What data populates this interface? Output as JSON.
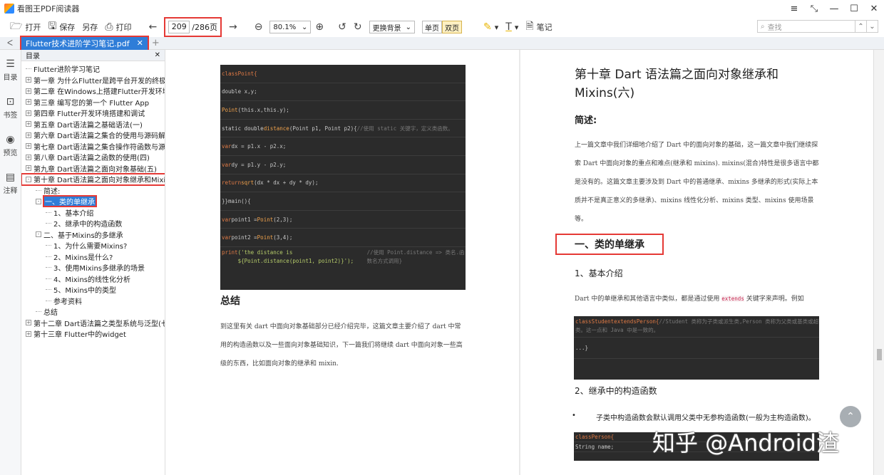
{
  "window": {
    "title": "看图王PDF阅读器",
    "controls": [
      "≡",
      "⤡",
      "—",
      "☐",
      "✕"
    ]
  },
  "toolbar": {
    "open": "打开",
    "save": "保存",
    "saveas": "另存",
    "print": "打印",
    "page_current": "209",
    "page_total": "/286页",
    "zoom": "80.1%",
    "background": "更换背景",
    "single": "单页",
    "double": "双页",
    "notes": "笔记"
  },
  "search": {
    "placeholder": "查找"
  },
  "tabs": [
    {
      "label": "Flutter技术进阶学习笔记.pdf"
    }
  ],
  "rail": [
    {
      "label": "目录"
    },
    {
      "label": "书签"
    },
    {
      "label": "预览"
    },
    {
      "label": "注释"
    }
  ],
  "toc": {
    "header": "目录",
    "items": [
      {
        "label": "Flutter进阶学习笔记",
        "level": 0,
        "expander": false
      },
      {
        "label": "第一章 为什么Flutter是跨平台开发的终极之选",
        "level": 0,
        "expander": "+"
      },
      {
        "label": "第二章 在Windows上搭建Flutter开发环境",
        "level": 0,
        "expander": "+"
      },
      {
        "label": "第三章 编写您的第一个 Flutter App",
        "level": 0,
        "expander": "+"
      },
      {
        "label": "第四章 Flutter开发环境搭建和调试",
        "level": 0,
        "expander": "+"
      },
      {
        "label": "第五章 Dart语法篇之基础语法(一)",
        "level": 0,
        "expander": "+"
      },
      {
        "label": "第六章 Dart语法篇之集合的使用与源码解析(二)",
        "level": 0,
        "expander": "+"
      },
      {
        "label": "第七章 Dart语法篇之集合操作符函数与源码分析(三)",
        "level": 0,
        "expander": "+"
      },
      {
        "label": "第八章 Dart语法篇之函数的使用(四)",
        "level": 0,
        "expander": "+"
      },
      {
        "label": "第九章 Dart语法篇之面向对象基础(五)",
        "level": 0,
        "expander": "+"
      },
      {
        "label": "第十章 Dart语法篇之面向对象继承和Mixins(六)",
        "level": 0,
        "expander": "-"
      },
      {
        "label": "简述:",
        "level": 1,
        "expander": false
      },
      {
        "label": "一、类的单继承",
        "level": 1,
        "expander": "-"
      },
      {
        "label": "1、基本介绍",
        "level": 2,
        "expander": false
      },
      {
        "label": "2、继承中的构造函数",
        "level": 2,
        "expander": false
      },
      {
        "label": "二、基于Mixins的多继承",
        "level": 1,
        "expander": "-"
      },
      {
        "label": "1、为什么需要Mixins?",
        "level": 2,
        "expander": false
      },
      {
        "label": "2、Mixins是什么?",
        "level": 2,
        "expander": false
      },
      {
        "label": "3、使用Mixins多继承的场景",
        "level": 2,
        "expander": false
      },
      {
        "label": "4、Mixins的线性化分析",
        "level": 2,
        "expander": false
      },
      {
        "label": "5、Mixins中的类型",
        "level": 2,
        "expander": false
      },
      {
        "label": "参考资料",
        "level": 2,
        "expander": false
      },
      {
        "label": "总结",
        "level": 1,
        "expander": false
      },
      {
        "label": "第十二章 Dart语法篇之类型系统与泛型(七)",
        "level": 0,
        "expander": "+"
      },
      {
        "label": "第十三章 Flutter中的widget",
        "level": 0,
        "expander": "+"
      }
    ]
  },
  "left_page": {
    "code_lines": [
      [
        {
          "t": "classPoint{",
          "c": "kw"
        }
      ],
      [
        {
          "t": "    double x,y;",
          "c": ""
        }
      ],
      [
        {
          "t": "Point",
          "c": "fn"
        },
        {
          "t": "(this.x,this.y);",
          "c": ""
        }
      ],
      [
        {
          "t": "static double ",
          "c": ""
        },
        {
          "t": "distance",
          "c": "fn"
        },
        {
          "t": "(Point p1, Point p2){",
          "c": ""
        },
        {
          "t": "//使用 static 关键字，定义类函数。",
          "c": "cm"
        }
      ],
      [
        {
          "t": "var",
          "c": "kw"
        },
        {
          "t": " dx = p1.x - p2.x;",
          "c": ""
        }
      ],
      [
        {
          "t": "var",
          "c": "kw"
        },
        {
          "t": " dy = p1.y - p2.y;",
          "c": ""
        }
      ],
      [
        {
          "t": "return",
          "c": "kw"
        },
        {
          "t": "sqrt",
          "c": "fn"
        },
        {
          "t": "(dx * dx + dy * dy);",
          "c": ""
        }
      ],
      [
        {
          "t": "}}main(){",
          "c": ""
        }
      ],
      [
        {
          "t": "var",
          "c": "kw"
        },
        {
          "t": " point1 =",
          "c": ""
        },
        {
          "t": "Point",
          "c": "fn"
        },
        {
          "t": "(2,3);",
          "c": ""
        }
      ],
      [
        {
          "t": "var",
          "c": "kw"
        },
        {
          "t": " point2 =",
          "c": ""
        },
        {
          "t": "Point",
          "c": "fn"
        },
        {
          "t": "(3,4);",
          "c": ""
        }
      ],
      [
        {
          "t": "print",
          "c": "kw"
        },
        {
          "t": "('the distance is ${Point.distance(point1, point2)}');",
          "c": "str"
        },
        {
          "t": "//使用 Point.distance => 类名.函数名方式调用}",
          "c": "cm"
        }
      ]
    ],
    "heading": "总结",
    "paragraph": "到这里有关 dart 中面向对象基础部分已经介绍完毕，这篇文章主要介绍了 dart 中常用的构造函数以及一些面向对象基础知识，下一篇我们将继续 dart 中面向对象一些高级的东西，比如面向对象的继承和 mixin."
  },
  "right_page": {
    "chapter_title": "第十章  Dart 语法篇之面向对象继承和 Mixins(六)",
    "intro_heading": "简述:",
    "intro_para": "上一篇文章中我们详细地介绍了 Dart 中的面向对象的基础，这一篇文章中我们继续探索 Dart 中面向对象的重点和难点(继承和 mixins). mixins(混合)特性是很多语言中都是没有的。这篇文章主要涉及到 Dart 中的普通继承、mixins 多继承的形式(实际上本质并不是真正意义的多继承)、mixins 线性化分析、mixins 类型、mixins 使用场景等。",
    "section1": "一、类的单继承",
    "sub1": "1、基本介绍",
    "sub1_para_a": "Dart 中的单继承和其他语言中类似，都是通过使用 ",
    "sub1_para_kw": "extends",
    "sub1_para_b": " 关键字来声明。例如",
    "code2_l1a": "classStudentextendsPerson{",
    "code2_l1b": "//Student 类称为子类或派生类,Person 类称为父类或基类或超类。这一点和 Java 中是一致的。",
    "code2_l2": "...}",
    "sub2": "2、继承中的构造函数",
    "bullet": "子类中构造函数会默认调用父类中无参构造函数(一般为主构造函数)。",
    "code3_l1": "classPerson{",
    "code3_l2": "  String name;"
  },
  "watermark": "知乎 @Android渣"
}
